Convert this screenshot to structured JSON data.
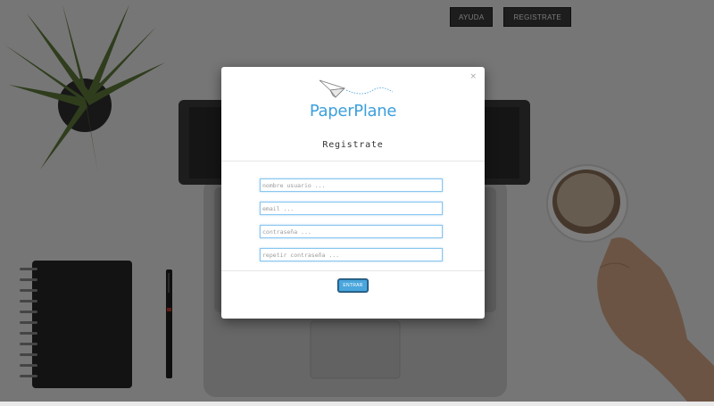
{
  "nav": {
    "help_label": "AYUDA",
    "signup_label": "REGISTRATE"
  },
  "modal": {
    "close_symbol": "×",
    "logo_text": "PaperPlane",
    "title": "Registrate",
    "fields": {
      "username_placeholder": "nombre usuario ...",
      "email_placeholder": "email ...",
      "password_placeholder": "contraseña ...",
      "repeat_password_placeholder": "repetir contraseña ..."
    },
    "submit_label": "ENTRAR"
  },
  "icons": {
    "logo": "paper-plane-icon",
    "close": "close-icon"
  },
  "colors": {
    "brand": "#3d9fdb",
    "button": "#4aa6dd",
    "input_focus_border": "#8ac6ef",
    "nav_button": "#3a3a3a",
    "overlay": "rgba(0,0,0,0.5)"
  }
}
